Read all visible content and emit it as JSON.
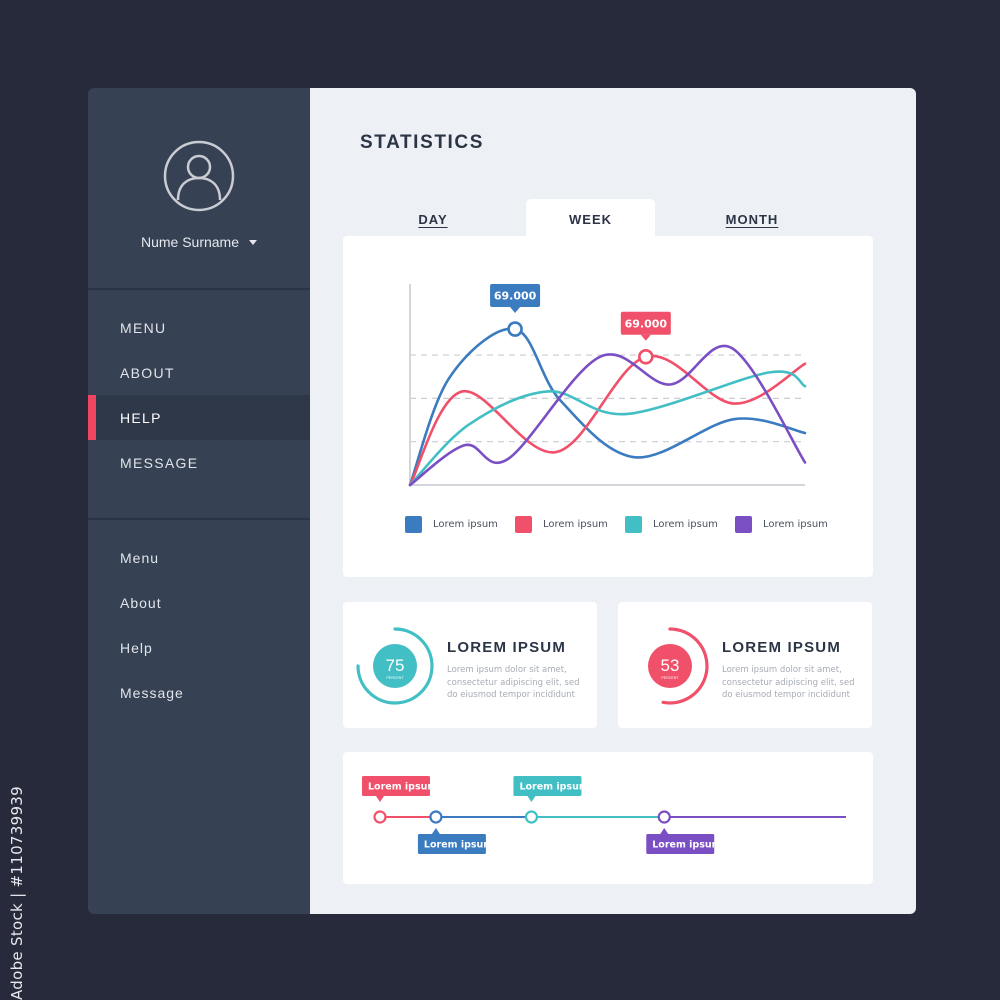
{
  "watermark": "Adobe Stock | #110739939",
  "sidebar": {
    "user_name": "Nume Surname",
    "primary_nav": [
      {
        "label": "MENU",
        "active": false
      },
      {
        "label": "ABOUT",
        "active": false
      },
      {
        "label": "HELP",
        "active": true
      },
      {
        "label": "MESSAGE",
        "active": false
      }
    ],
    "secondary_nav": [
      {
        "label": "Menu"
      },
      {
        "label": "About"
      },
      {
        "label": "Help"
      },
      {
        "label": "Message"
      }
    ]
  },
  "main": {
    "title": "STATISTICS",
    "tabs": [
      {
        "label": "DAY",
        "active": false
      },
      {
        "label": "WEEK",
        "active": true
      },
      {
        "label": "MONTH",
        "active": false
      }
    ],
    "stat_cards": [
      {
        "value": "75",
        "unit": "PERCENT",
        "percent": 75,
        "title": "LOREM IPSUM",
        "description": "Lorem ipsum dolor sit amet, consectetur adipiscing elit, sed do eiusmod tempor incididunt",
        "color": "#42bfc5"
      },
      {
        "value": "53",
        "unit": "PERCENT",
        "percent": 53,
        "title": "LOREM IPSUM",
        "description": "Lorem ipsum dolor sit amet, consectetur adipiscing elit, sed do eiusmod tempor incididunt",
        "color": "#f0506a"
      }
    ],
    "timeline": {
      "events": [
        {
          "label": "Lorem ipsum",
          "position": 0.0,
          "color": "#f0506a",
          "label_side": "top"
        },
        {
          "label": "Lorem ipsum",
          "position": 0.12,
          "color": "#3b7bbf",
          "label_side": "bottom"
        },
        {
          "label": "Lorem ipsum",
          "position": 0.325,
          "color": "#42bfc5",
          "label_side": "top"
        },
        {
          "label": "Lorem ipsum",
          "position": 0.61,
          "color": "#7b4fc4",
          "label_side": "bottom"
        }
      ]
    }
  },
  "chart_data": {
    "type": "line",
    "title": "",
    "xlabel": "",
    "ylabel": "",
    "xlim": [
      0,
      10
    ],
    "ylim": [
      0,
      116
    ],
    "grid": "dashed horizontal",
    "gridlines": [
      25,
      50,
      75
    ],
    "legend_position": "bottom",
    "series": [
      {
        "name": "Lorem ipsum",
        "color": "#3b7bbf",
        "x": [
          0,
          1.0,
          2.66,
          3.8,
          5.7,
          8.2,
          10
        ],
        "y": [
          0,
          62,
          90,
          49,
          16,
          38,
          30
        ]
      },
      {
        "name": "Lorem ipsum",
        "color": "#f0506a",
        "x": [
          0,
          1.32,
          3.7,
          5.97,
          8.2,
          10
        ],
        "y": [
          0,
          54,
          19,
          74,
          47,
          70
        ]
      },
      {
        "name": "Lorem ipsum",
        "color": "#42bfc5",
        "x": [
          0,
          1.5,
          3.5,
          5.5,
          9.1,
          10
        ],
        "y": [
          0,
          35,
          54,
          41,
          65,
          57
        ]
      },
      {
        "name": "Lorem ipsum",
        "color": "#7b4fc4",
        "x": [
          0,
          1.39,
          2.48,
          4.81,
          6.58,
          8.15,
          10
        ],
        "y": [
          0,
          23,
          15,
          74,
          58,
          79,
          13
        ]
      }
    ],
    "annotations": [
      {
        "series": 0,
        "x": 2.66,
        "y": 90,
        "label": "69.000"
      },
      {
        "series": 1,
        "x": 5.97,
        "y": 74,
        "label": "69.000"
      }
    ]
  }
}
